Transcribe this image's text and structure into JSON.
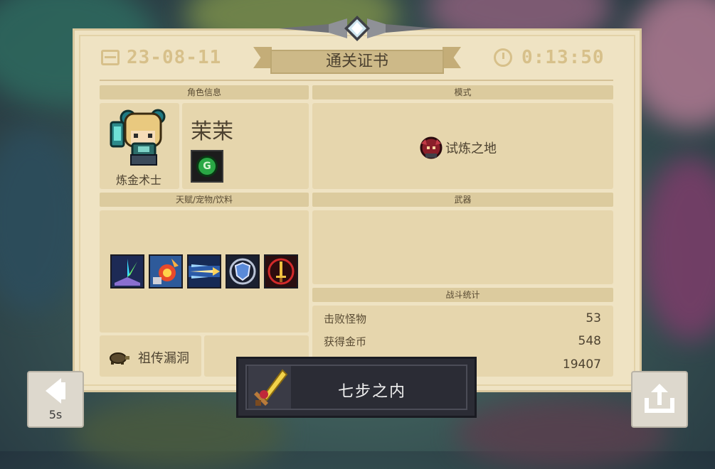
{
  "header": {
    "date": "23-08-11",
    "title": "通关证书",
    "time": "0:13:50",
    "icons": {
      "date": "calendar-icon",
      "time": "clock-icon"
    }
  },
  "sections": {
    "character_info": "角色信息",
    "mode": "模式",
    "talents": "天赋/宠物/饮料",
    "weapons": "武器",
    "battle_stats": "战斗统计"
  },
  "character": {
    "name": "茉茉",
    "job": "炼金术士",
    "badge_letter": "G"
  },
  "mode": {
    "label": "试炼之地",
    "icon": "trial-land-icon"
  },
  "talents": [
    "burst-magic-icon",
    "explosion-icon",
    "arrow-volley-icon",
    "shield-badge-icon",
    "sword-red-icon"
  ],
  "heirloom": {
    "label": "祖传漏洞",
    "icon": "turtle-icon"
  },
  "stats": [
    {
      "label": "击败怪物",
      "value": "53"
    },
    {
      "label": "获得金币",
      "value": "548"
    },
    {
      "label": "",
      "value": "19407"
    }
  ],
  "achievement": {
    "label": "七步之内",
    "icon": "golden-sword-icon"
  },
  "nav": {
    "back_countdown": "5s"
  },
  "colors": {
    "card_bg": "#efe3c3",
    "section_head": "#dccb9e",
    "panel": "#e6d6ad",
    "header_text": "#d7c08a",
    "achievement_bg": "#2b2c35"
  }
}
